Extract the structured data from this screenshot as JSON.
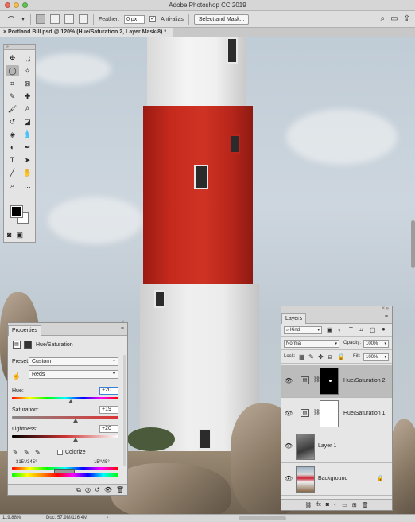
{
  "app": {
    "title": "Adobe Photoshop CC 2019"
  },
  "options_bar": {
    "feather_label": "Feather:",
    "feather_value": "0 px",
    "antialias_label": "Anti-alias",
    "select_mask_label": "Select and Mask..."
  },
  "document": {
    "tab_title": "Portland Bill.psd @ 120% (Hue/Saturation 2, Layer Mask/8) *"
  },
  "properties": {
    "tab_label": "Properties",
    "adjustment_title": "Hue/Saturation",
    "preset_label": "Preset:",
    "preset_value": "Custom",
    "channel_value": "Reds",
    "hue_label": "Hue:",
    "hue_value": "+20",
    "hue_level": 20,
    "saturation_label": "Saturation:",
    "saturation_value": "+19",
    "saturation_level": 19,
    "lightness_label": "Lightness:",
    "lightness_value": "+20",
    "lightness_level": 20,
    "colorize_label": "Colorize",
    "range_left": "315°/345°",
    "range_right": "15°\\45°"
  },
  "layers": {
    "tab_label": "Layers",
    "filter_kind": "Kind",
    "blend_mode": "Normal",
    "opacity_label": "Opacity:",
    "opacity_value": "100%",
    "lock_label": "Lock:",
    "fill_label": "Fill:",
    "fill_value": "100%",
    "items": [
      {
        "name": "Hue/Saturation 2",
        "selected": true
      },
      {
        "name": "Hue/Saturation 1",
        "selected": false
      },
      {
        "name": "Layer 1",
        "selected": false
      },
      {
        "name": "Background",
        "selected": false
      }
    ]
  },
  "status": {
    "zoom": "119.88%",
    "doc_info": "Doc: 57.9M/116.4M"
  },
  "colors": {
    "tower_red": "#c52a1d",
    "sky": "#c6d0d8",
    "panel": "#e6e6e6",
    "focus": "#3a7fd8"
  },
  "icons": [
    "lasso-icon",
    "move-icon",
    "marquee-icon",
    "brush-icon",
    "type-icon",
    "hand-icon",
    "zoom-icon",
    "eye-icon",
    "lock-icon",
    "trash-icon"
  ]
}
